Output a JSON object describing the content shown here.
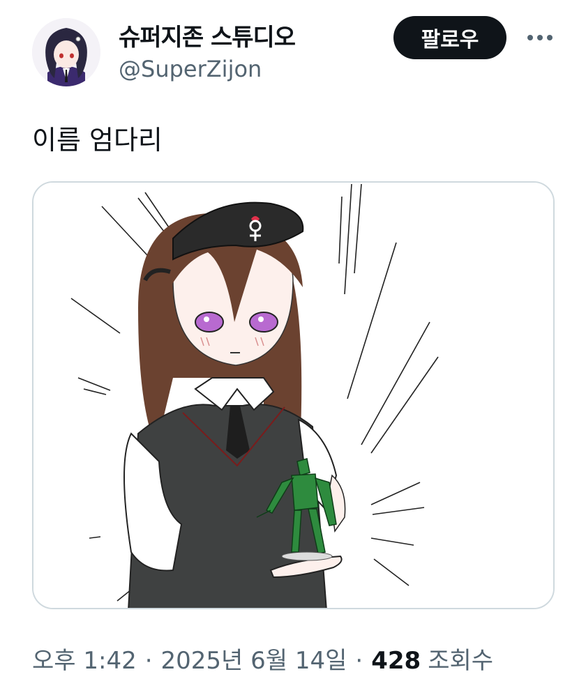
{
  "post": {
    "author": {
      "display_name": "슈퍼지존 스튜디오",
      "handle": "@SuperZijon"
    },
    "follow_label": "팔로우",
    "more_icon": "more-horizontal-icon",
    "text": "이름 엄다리",
    "meta": {
      "time": "오후 1:42",
      "separator": "·",
      "date": "2025년 6월 14일",
      "views_count": "428",
      "views_label": "조회수"
    }
  },
  "colors": {
    "primary_text": "#0f1419",
    "secondary_text": "#536471",
    "button_bg": "#0f1419",
    "card_border": "#cfd9de"
  }
}
